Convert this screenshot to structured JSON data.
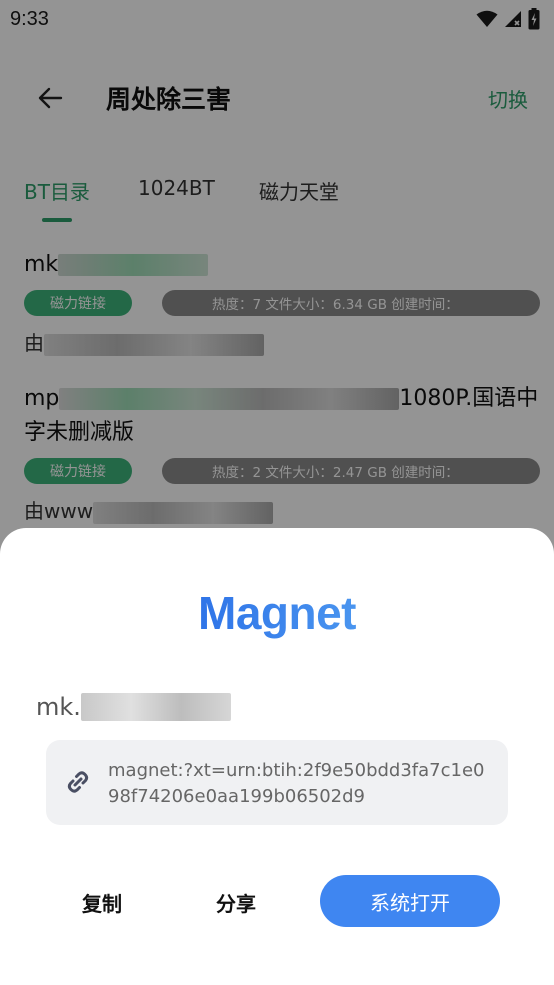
{
  "status_bar": {
    "time": "9:33",
    "icons": [
      "wifi-icon",
      "cellular-signal-icon",
      "battery-icon"
    ]
  },
  "app_bar": {
    "title": "周处除三害",
    "switch_label": "切换"
  },
  "tabs": [
    {
      "label": "BT目录",
      "active": true
    },
    {
      "label": "1024BT",
      "active": false
    },
    {
      "label": "磁力天堂",
      "active": false
    }
  ],
  "list": [
    {
      "title_prefix": "mk",
      "title_suffix": "",
      "tag": "磁力链接",
      "info": "热度：7  文件大小：6.34 GB  创建时间：",
      "source_prefix": "由"
    },
    {
      "title_prefix": "mp",
      "title_suffix": "1080P.国语中字未删减版",
      "tag": "磁力链接",
      "info": "热度：2  文件大小：2.47 GB  创建时间：",
      "source_prefix": "由www"
    }
  ],
  "sheet": {
    "logo": "Magnet",
    "name_prefix": "mk.",
    "magnet_link": "magnet:?xt=urn:btih:2f9e50bdd3fa7c1e098f74206e0aa199b06502d9",
    "copy_label": "复制",
    "share_label": "分享",
    "open_label": "系统打开"
  },
  "colors": {
    "accent_green": "#2e9e6a",
    "tag_green": "#3db37b",
    "primary_blue": "#3f86f1"
  }
}
